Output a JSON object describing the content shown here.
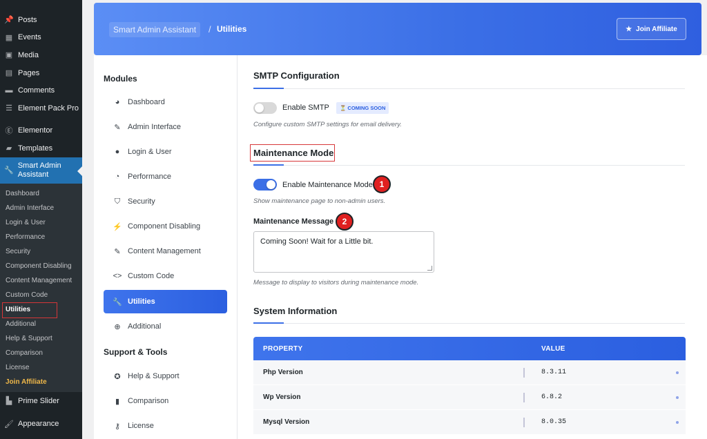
{
  "wp_menu": {
    "items_top": [
      {
        "label": "Posts",
        "icon": "pin-icon"
      },
      {
        "label": "Events",
        "icon": "calendar-icon"
      },
      {
        "label": "Media",
        "icon": "media-icon"
      },
      {
        "label": "Pages",
        "icon": "page-icon"
      },
      {
        "label": "Comments",
        "icon": "comment-icon"
      },
      {
        "label": "Element Pack Pro",
        "icon": "element-pack-icon"
      },
      {
        "label": "Elementor",
        "icon": "elementor-icon"
      },
      {
        "label": "Templates",
        "icon": "folder-icon"
      }
    ],
    "active": {
      "label": "Smart Admin Assistant",
      "icon": "wrench-icon"
    },
    "submenu": [
      "Dashboard",
      "Admin Interface",
      "Login & User",
      "Performance",
      "Security",
      "Component Disabling",
      "Content Management",
      "Custom Code",
      "Utilities",
      "Additional",
      "Help & Support",
      "Comparison",
      "License",
      "Join Affiliate"
    ],
    "items_bottom": [
      {
        "label": "Prime Slider",
        "icon": "prime-slider-icon"
      },
      {
        "label": "Appearance",
        "icon": "brush-icon"
      }
    ]
  },
  "header": {
    "breadcrumb_root": "Smart Admin Assistant",
    "separator": "/",
    "breadcrumb_current": "Utilities",
    "join_button": "Join Affiliate"
  },
  "modules_panel": {
    "heading": "Modules",
    "items": [
      {
        "label": "Dashboard",
        "icon": "dashboard-icon"
      },
      {
        "label": "Admin Interface",
        "icon": "pin-icon"
      },
      {
        "label": "Login & User",
        "icon": "user-icon"
      },
      {
        "label": "Performance",
        "icon": "gauge-icon"
      },
      {
        "label": "Security",
        "icon": "shield-icon"
      },
      {
        "label": "Component Disabling",
        "icon": "plug-icon"
      },
      {
        "label": "Content Management",
        "icon": "pin-icon"
      },
      {
        "label": "Custom Code",
        "icon": "code-icon"
      },
      {
        "label": "Utilities",
        "icon": "wrench-icon"
      },
      {
        "label": "Additional",
        "icon": "plus-circle-icon"
      }
    ],
    "support_heading": "Support & Tools",
    "support_items": [
      {
        "label": "Help & Support",
        "icon": "lifebuoy-icon"
      },
      {
        "label": "Comparison",
        "icon": "bar-chart-icon"
      },
      {
        "label": "License",
        "icon": "key-icon"
      }
    ]
  },
  "smtp": {
    "title": "SMTP Configuration",
    "toggle_label": "Enable SMTP",
    "badge": "⏳ COMING SOON",
    "help": "Configure custom SMTP settings for email delivery.",
    "enabled": false
  },
  "maintenance": {
    "title": "Maintenance Mode",
    "toggle_label": "Enable Maintenance Mode",
    "enabled": true,
    "help": "Show maintenance page to non-admin users.",
    "message_label": "Maintenance Message",
    "message_value": "Coming Soon! Wait for a Little bit.",
    "message_help": "Message to display to visitors during maintenance mode.",
    "callout_1": "1",
    "callout_2": "2"
  },
  "system_info": {
    "title": "System Information",
    "columns": [
      "PROPERTY",
      "VALUE"
    ],
    "rows": [
      {
        "property": "Php Version",
        "value": "8.3.11"
      },
      {
        "property": "Wp Version",
        "value": "6.8.2"
      },
      {
        "property": "Mysql Version",
        "value": "8.0.35"
      }
    ]
  },
  "colors": {
    "accent": "#3b6fe6",
    "wp_sidebar": "#1d2327",
    "wp_active": "#2271b1",
    "highlight_red": "#d63638",
    "affiliate": "#f0b849"
  }
}
